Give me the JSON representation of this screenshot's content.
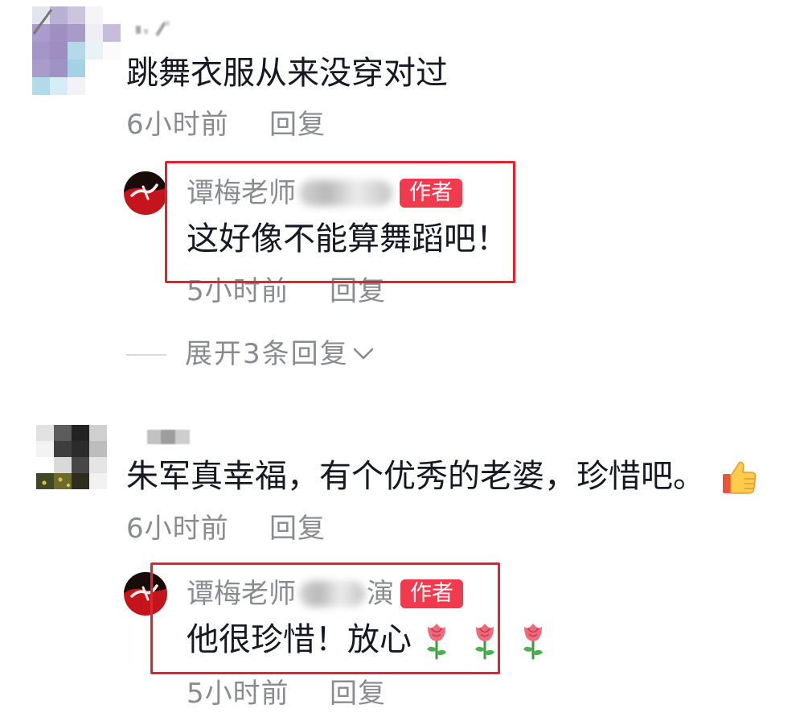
{
  "colors": {
    "background": "#ffffff",
    "text_primary": "#161823",
    "text_secondary": "#8a8b91",
    "author_badge_bg": "#f23a4f",
    "author_badge_text": "#ffffff",
    "highlight_border": "#e3232b",
    "divider": "#d9d9d9"
  },
  "comments": [
    {
      "text": "跳舞衣服从来没穿对过",
      "time": "6小时前",
      "reply_label": "回复",
      "replies": [
        {
          "username": "谭梅老师",
          "author_badge": "作者",
          "text": "这好像不能算舞蹈吧！",
          "time": "5小时前",
          "reply_label": "回复"
        }
      ],
      "expand_replies_label": "展开3条回复"
    },
    {
      "text": "朱军真幸福，有个优秀的老婆，珍惜吧。",
      "emoji": [
        "thumbs-up-icon"
      ],
      "time": "6小时前",
      "reply_label": "回复",
      "replies": [
        {
          "username": "谭梅老师",
          "username_tail": "演",
          "author_badge": "作者",
          "text": "他很珍惜！放心",
          "emoji": [
            "rose-icon",
            "rose-icon",
            "rose-icon"
          ],
          "time": "5小时前",
          "reply_label": "回复"
        }
      ]
    }
  ]
}
